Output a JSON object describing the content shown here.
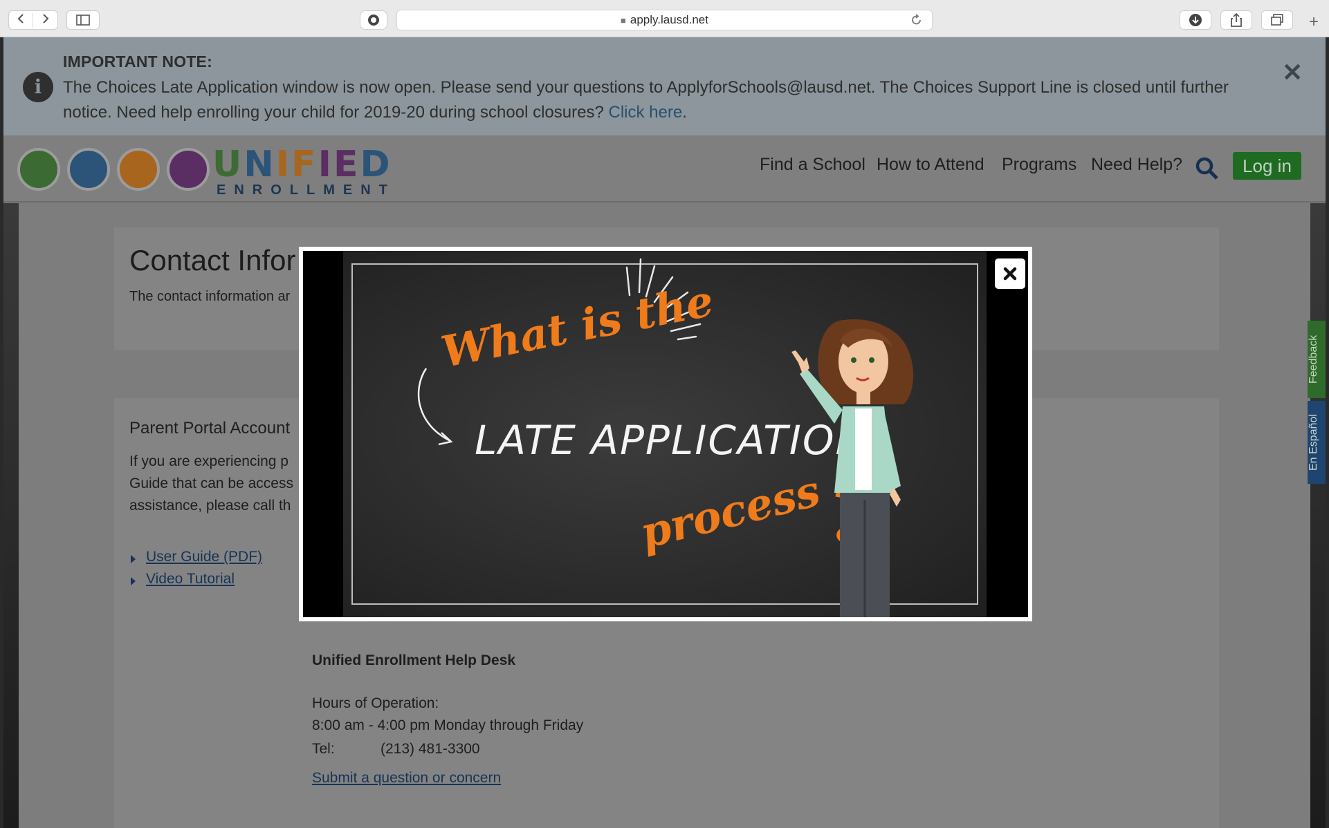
{
  "browser": {
    "url": "apply.lausd.net"
  },
  "notice": {
    "title": "IMPORTANT NOTE:",
    "message": "The Choices Late Application window is now open. Please send your questions to ApplyforSchools@lausd.net. The Choices Support Line is closed until further notice. Need help enrolling your child for 2019-20 during school closures? ",
    "link": "Click here",
    "link_suffix": "."
  },
  "header": {
    "logo_word": "UNIFIED",
    "logo_sub": "ENROLLMENT",
    "nav": [
      "Find a School",
      "How to Attend",
      "Programs",
      "Need Help?"
    ],
    "login": "Log in"
  },
  "content": {
    "title": "Contact Infor",
    "intro": "The contact information ar",
    "portal_heading": "Parent Portal Account",
    "portal_lines": [
      "If you are experiencing p",
      "Guide that can be access",
      "assistance, please call th"
    ],
    "links": [
      "User Guide (PDF)",
      "Video Tutorial"
    ],
    "helpdesk_title": "Unified Enrollment Help Desk",
    "hours_label": "Hours of Operation:",
    "hours": "8:00 am - 4:00 pm Monday through Friday",
    "tel_label": "Tel:",
    "tel": "(213) 481-3300",
    "submit_link": "Submit a question or concern"
  },
  "side_tabs": {
    "feedback": "Feedback",
    "espanol": "En Español"
  },
  "video": {
    "line1": "What is the",
    "line2": "LATE APPLICATION",
    "line3": "process",
    "qmark": "?"
  },
  "colors": {
    "accent_orange": "#f07b1a",
    "login_green": "#1f6b22",
    "link_blue": "#173356"
  }
}
